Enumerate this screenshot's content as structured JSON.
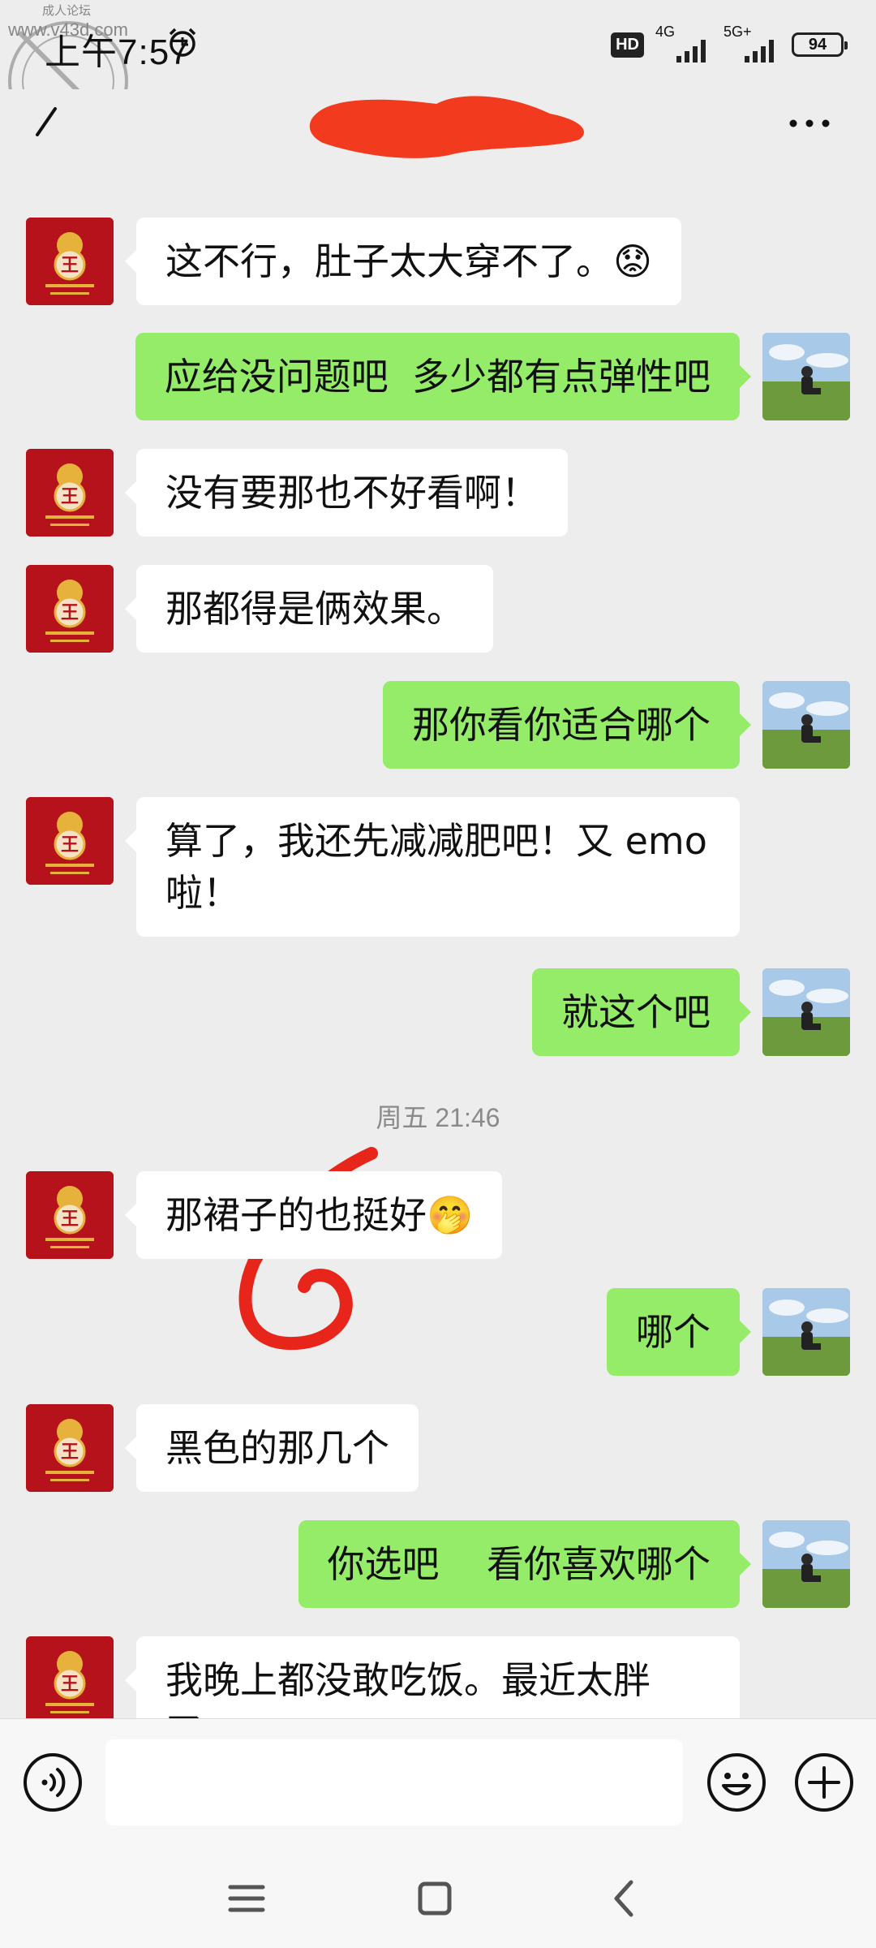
{
  "watermark": {
    "top_text": "成人论坛",
    "site": "www.v43d.com",
    "stamp_text": "Taijiao.com 台湾海社区"
  },
  "status_bar": {
    "time": "上午7:57",
    "hd_badge": "HD",
    "signal_1": "4G",
    "signal_2": "5G+",
    "battery": "94",
    "icons": [
      "alarm-icon",
      "signal-icon",
      "battery-icon"
    ]
  },
  "nav": {
    "title_redacted": true,
    "back_icon": "back-icon",
    "more_icon": "more-icon"
  },
  "messages": [
    {
      "from": "peer",
      "text": "这不行，肚子太大穿不了。😟"
    },
    {
      "from": "me",
      "text": "应给没问题吧  多少都有点弹性吧"
    },
    {
      "from": "peer",
      "text": "没有要那也不好看啊！"
    },
    {
      "from": "peer",
      "text": "那都得是俩效果。"
    },
    {
      "from": "me",
      "text": "那你看你适合哪个"
    },
    {
      "from": "peer",
      "text": "算了，我还先减减肥吧！又 emo\n啦！"
    },
    {
      "from": "me",
      "text": "就这个吧"
    },
    {
      "type": "timestamp",
      "text": "周五 21:46"
    },
    {
      "from": "peer",
      "text": "那裙子的也挺好🤭"
    },
    {
      "from": "me",
      "text": "哪个"
    },
    {
      "from": "peer",
      "text": "黑色的那几个"
    },
    {
      "from": "me",
      "text": "你选吧    看你喜欢哪个"
    },
    {
      "from": "peer",
      "text": "我晚上都没敢吃饭。最近太胖了。"
    }
  ],
  "peer_avatar": {
    "glyph": "王"
  },
  "colors": {
    "background": "#ededed",
    "bubble_me": "#95ec69",
    "bubble_peer": "#ffffff",
    "annotation": "#e8251a",
    "avatar_peer": "#b5121b"
  },
  "input": {
    "value": "",
    "placeholder": "",
    "icons": [
      "voice-icon",
      "emoji-icon",
      "plus-icon"
    ]
  },
  "system_nav": {
    "icons": [
      "menu-icon",
      "home-icon",
      "back-nav-icon"
    ]
  }
}
